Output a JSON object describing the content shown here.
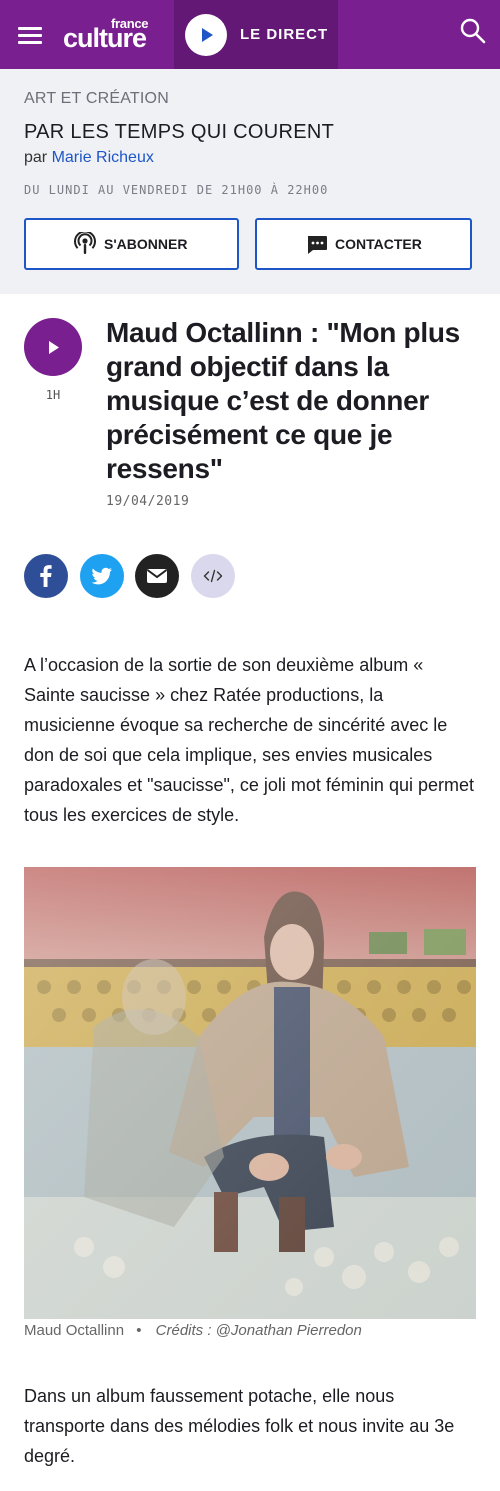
{
  "header": {
    "brand_small": "france",
    "brand_big": "culture",
    "live_label": "LE DIRECT",
    "icons": [
      "menu-icon",
      "play-icon",
      "search-icon"
    ],
    "brand_color": "#7a1f8f"
  },
  "show": {
    "category": "ART ET CRÉATION",
    "title": "PAR LES TEMPS QUI COURENT",
    "by_prefix": "par",
    "author": "Marie Richeux",
    "schedule": "DU LUNDI AU VENDREDI DE 21H00 À 22H00",
    "subscribe_label": "S'ABONNER",
    "contact_label": "CONTACTER"
  },
  "episode": {
    "duration": "1H",
    "title": "Maud Octallinn : \"Mon plus grand objectif dans la musique c’est de donner précisément ce que je ressens\"",
    "date": "19/04/2019"
  },
  "share": {
    "icons": [
      "facebook-icon",
      "twitter-icon",
      "mail-icon",
      "embed-icon"
    ],
    "colors": {
      "facebook": "#2e4e98",
      "twitter": "#1ea1f1",
      "mail": "#222222",
      "embed": "#d9d8ec"
    }
  },
  "article": {
    "intro": "A l’occasion de la sortie de son deuxième album « Sainte saucisse » chez Ratée productions, la musicienne évoque sa recherche de sincérité avec le don de soi que cela implique, ses envies musicales paradoxales et \"saucisse\", ce joli mot féminin qui permet tous les exercices de style.",
    "photo_caption": "Maud Octallinn",
    "caption_separator": "•",
    "photo_credits": "Crédits : @Jonathan Pierredon",
    "paragraph2": "Dans un album faussement potache, elle nous transporte dans des mélodies folk et nous invite au 3e degré."
  }
}
